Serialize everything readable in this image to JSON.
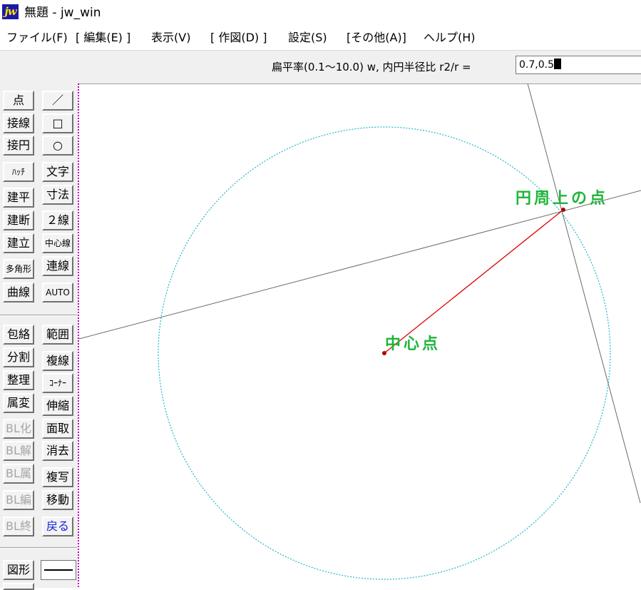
{
  "window": {
    "icon_text": "jw",
    "title": "無題 - jw_win"
  },
  "menu": [
    {
      "label": "ファイル(F)"
    },
    {
      "label": "[ 編集(E) ]"
    },
    {
      "label": "表示(V)"
    },
    {
      "label": "[ 作図(D) ]"
    },
    {
      "label": "設定(S)"
    },
    {
      "label": "[その他(A)]"
    },
    {
      "label": "ヘルプ(H)"
    }
  ],
  "prompt": {
    "label": "扁平率(0.1～10.0) w, 内円半径比 r2/r =",
    "value": "0.7,0.5"
  },
  "toolbox": {
    "left": [
      "点",
      "接線",
      "接円",
      "ﾊｯﾁ",
      "建平",
      "建断",
      "建立",
      "多角形",
      "曲線",
      "包絡",
      "分割",
      "整理",
      "属変",
      "BL化",
      "BL解",
      "BL属",
      "BL編",
      "BL終",
      "図形"
    ],
    "right": [
      "／",
      "□",
      "○",
      "文字",
      "寸法",
      "２線",
      "中心線",
      "連線",
      "AUTO",
      "範囲",
      "複線",
      "ｺｰﾅｰ",
      "伸縮",
      "面取",
      "消去",
      "複写",
      "移動",
      "戻る"
    ]
  },
  "drawing": {
    "center_label": "中心点",
    "point_label": "円周上の点"
  },
  "colors": {
    "circle": "#1fb8c8",
    "radius_line": "#e00000",
    "aux_line": "#6a6a6a",
    "label": "#1fb53a"
  }
}
